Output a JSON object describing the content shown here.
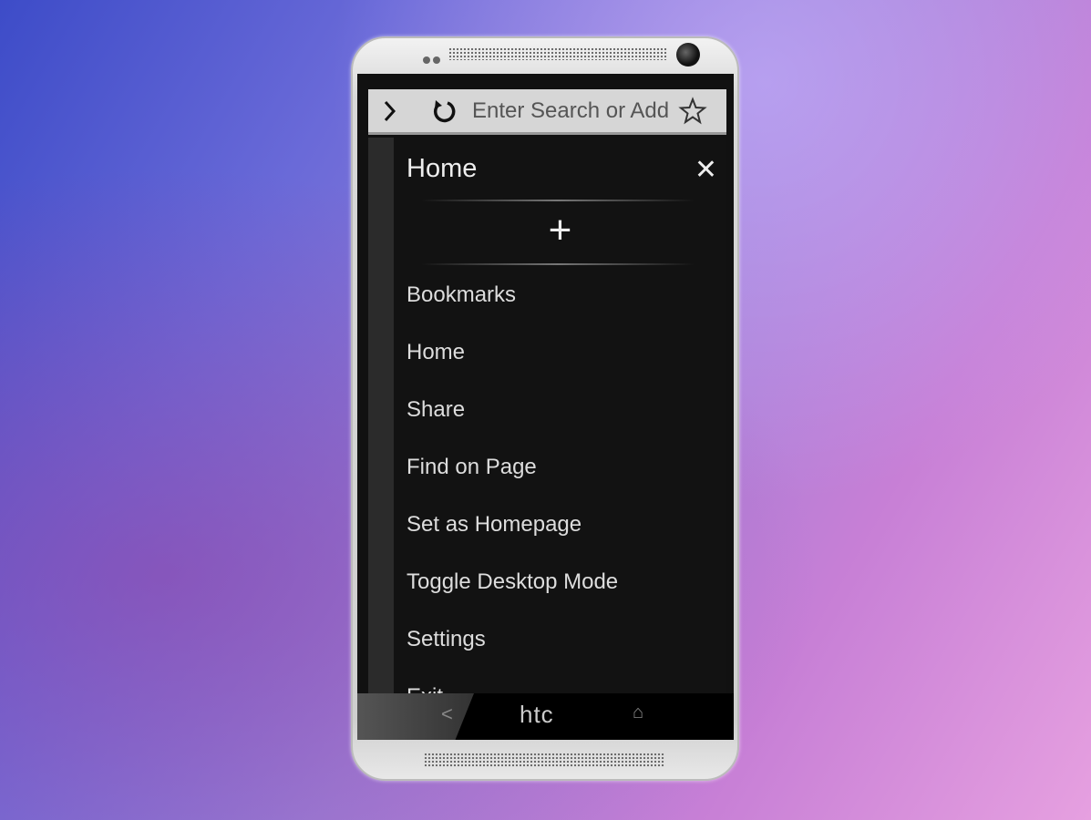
{
  "browser": {
    "address_placeholder": "Enter Search or Add",
    "forward_icon": "chevron-right-icon",
    "reload_icon": "reload-icon",
    "bookmark_icon": "star-icon"
  },
  "menu": {
    "title": "Home",
    "close_icon": "close-icon",
    "add_icon": "plus-icon",
    "items": [
      {
        "label": "Bookmarks"
      },
      {
        "label": "Home"
      },
      {
        "label": "Share"
      },
      {
        "label": "Find on Page"
      },
      {
        "label": "Set as Homepage"
      },
      {
        "label": "Toggle Desktop Mode"
      },
      {
        "label": "Settings"
      },
      {
        "label": "Exit"
      }
    ]
  },
  "device": {
    "brand": "htc",
    "back_glyph": "<",
    "home_glyph": "⌂"
  }
}
